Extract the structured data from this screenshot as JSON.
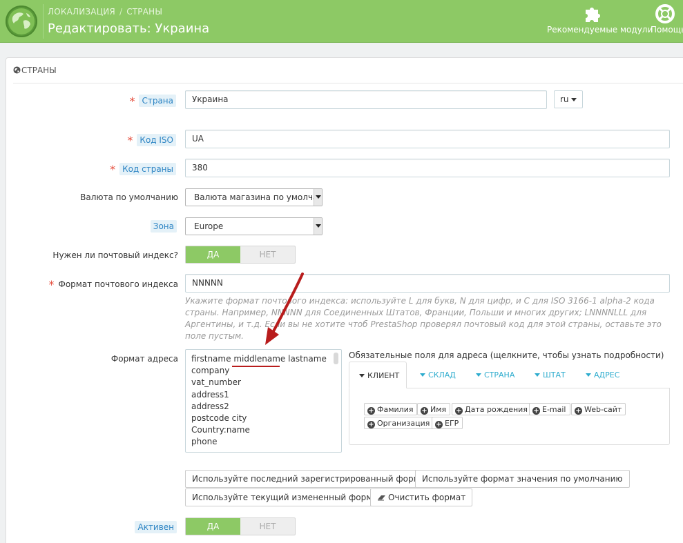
{
  "header": {
    "breadcrumb": [
      "ЛОКАЛИЗАЦИЯ",
      "СТРАНЫ"
    ],
    "breadcrumb_sep": "/",
    "title": "Редактировать: Украина",
    "buttons": {
      "modules": "Рекомендуемые модули",
      "help": "Помощь"
    },
    "icons": {
      "logo": "globe-icon",
      "modules": "puzzle-icon",
      "help": "lifebuoy-icon"
    }
  },
  "panel": {
    "title": "СТРАНЫ",
    "icon": "globe-small-icon"
  },
  "form": {
    "country": {
      "label": "Страна",
      "value": "Украина",
      "lang": "ru"
    },
    "iso": {
      "label": "Код ISO",
      "value": "UA"
    },
    "call_prefix": {
      "label": "Код страны",
      "value": "380"
    },
    "currency": {
      "label": "Валюта по умолчанию",
      "value": "Валюта магазина по умолчанию"
    },
    "zone": {
      "label": "Зона",
      "value": "Europe"
    },
    "need_zip": {
      "label": "Нужен ли почтовый индекс?",
      "yes": "ДА",
      "no": "НЕТ"
    },
    "zip_format": {
      "label": "Формат почтового индекса",
      "value": "NNNNN",
      "help": "Укажите формат почтового индекса: используйте L для букв, N для цифр, и C для ISO 3166-1 alpha-2 кода страны. Например, NNNNN для Соединенных Штатов, Франции, Польши и многих других; LNNNNLLL для Аргентины, и т.д. Если вы не хотите чтоб PrestaShop проверял почтовый код для этой страны, оставьте это поле пустым."
    },
    "address_format": {
      "label": "Формат адреса",
      "lines": [
        [
          "firstname",
          "middlename",
          "lastname"
        ],
        "company",
        "vat_number",
        "address1",
        "address2",
        "postcode city",
        "Country:name",
        "phone"
      ]
    },
    "required_fields": {
      "title": "Обязательные поля для адреса (щелкните, чтобы узнать подробности)",
      "tabs": [
        "КЛИЕНТ",
        "СКЛАД",
        "СТРАНА",
        "ШТАТ",
        "АДРЕС"
      ],
      "active_tab": "КЛИЕНТ",
      "fields": [
        "Фамилия",
        "Имя",
        "Дата рождения",
        "E-mail",
        "Web-сайт",
        "Организация",
        "ЕГР"
      ]
    },
    "format_buttons": {
      "last_registered": "Используйте последний зарегистрированный формат",
      "default": "Используйте формат значения по умолчанию",
      "current": "Используйте текущий измененный формат",
      "clear": "Очистить формат"
    },
    "active": {
      "label": "Активен",
      "yes": "ДА",
      "no": "НЕТ"
    }
  },
  "colors": {
    "header_green": "#8dc965",
    "accent_blue": "#2eacce",
    "required_red": "#e54d3c",
    "annotation_red": "#b81c1c"
  }
}
